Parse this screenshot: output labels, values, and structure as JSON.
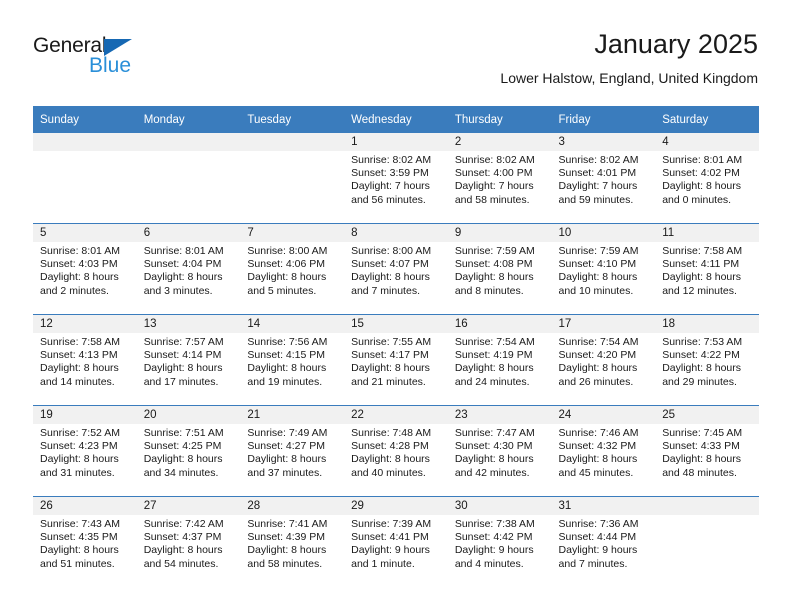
{
  "brand": {
    "name_top": "General",
    "name_bottom": "Blue",
    "accent_color": "#1668b3",
    "blue_text_color": "#2a8fd8"
  },
  "header": {
    "title": "January 2025",
    "subtitle": "Lower Halstow, England, United Kingdom"
  },
  "theme": {
    "header_bg": "#3a7cbd",
    "daynum_bg": "#f1f1f1",
    "text": "#1a1a1a"
  },
  "weekdays": [
    "Sunday",
    "Monday",
    "Tuesday",
    "Wednesday",
    "Thursday",
    "Friday",
    "Saturday"
  ],
  "weeks": [
    [
      {
        "day": "",
        "empty": true,
        "sunrise": "",
        "sunset": "",
        "daylight_line1": "",
        "daylight_line2": ""
      },
      {
        "day": "",
        "empty": true,
        "sunrise": "",
        "sunset": "",
        "daylight_line1": "",
        "daylight_line2": ""
      },
      {
        "day": "",
        "empty": true,
        "sunrise": "",
        "sunset": "",
        "daylight_line1": "",
        "daylight_line2": ""
      },
      {
        "day": "1",
        "empty": false,
        "sunrise": "Sunrise: 8:02 AM",
        "sunset": "Sunset: 3:59 PM",
        "daylight_line1": "Daylight: 7 hours",
        "daylight_line2": "and 56 minutes."
      },
      {
        "day": "2",
        "empty": false,
        "sunrise": "Sunrise: 8:02 AM",
        "sunset": "Sunset: 4:00 PM",
        "daylight_line1": "Daylight: 7 hours",
        "daylight_line2": "and 58 minutes."
      },
      {
        "day": "3",
        "empty": false,
        "sunrise": "Sunrise: 8:02 AM",
        "sunset": "Sunset: 4:01 PM",
        "daylight_line1": "Daylight: 7 hours",
        "daylight_line2": "and 59 minutes."
      },
      {
        "day": "4",
        "empty": false,
        "sunrise": "Sunrise: 8:01 AM",
        "sunset": "Sunset: 4:02 PM",
        "daylight_line1": "Daylight: 8 hours",
        "daylight_line2": "and 0 minutes."
      }
    ],
    [
      {
        "day": "5",
        "empty": false,
        "sunrise": "Sunrise: 8:01 AM",
        "sunset": "Sunset: 4:03 PM",
        "daylight_line1": "Daylight: 8 hours",
        "daylight_line2": "and 2 minutes."
      },
      {
        "day": "6",
        "empty": false,
        "sunrise": "Sunrise: 8:01 AM",
        "sunset": "Sunset: 4:04 PM",
        "daylight_line1": "Daylight: 8 hours",
        "daylight_line2": "and 3 minutes."
      },
      {
        "day": "7",
        "empty": false,
        "sunrise": "Sunrise: 8:00 AM",
        "sunset": "Sunset: 4:06 PM",
        "daylight_line1": "Daylight: 8 hours",
        "daylight_line2": "and 5 minutes."
      },
      {
        "day": "8",
        "empty": false,
        "sunrise": "Sunrise: 8:00 AM",
        "sunset": "Sunset: 4:07 PM",
        "daylight_line1": "Daylight: 8 hours",
        "daylight_line2": "and 7 minutes."
      },
      {
        "day": "9",
        "empty": false,
        "sunrise": "Sunrise: 7:59 AM",
        "sunset": "Sunset: 4:08 PM",
        "daylight_line1": "Daylight: 8 hours",
        "daylight_line2": "and 8 minutes."
      },
      {
        "day": "10",
        "empty": false,
        "sunrise": "Sunrise: 7:59 AM",
        "sunset": "Sunset: 4:10 PM",
        "daylight_line1": "Daylight: 8 hours",
        "daylight_line2": "and 10 minutes."
      },
      {
        "day": "11",
        "empty": false,
        "sunrise": "Sunrise: 7:58 AM",
        "sunset": "Sunset: 4:11 PM",
        "daylight_line1": "Daylight: 8 hours",
        "daylight_line2": "and 12 minutes."
      }
    ],
    [
      {
        "day": "12",
        "empty": false,
        "sunrise": "Sunrise: 7:58 AM",
        "sunset": "Sunset: 4:13 PM",
        "daylight_line1": "Daylight: 8 hours",
        "daylight_line2": "and 14 minutes."
      },
      {
        "day": "13",
        "empty": false,
        "sunrise": "Sunrise: 7:57 AM",
        "sunset": "Sunset: 4:14 PM",
        "daylight_line1": "Daylight: 8 hours",
        "daylight_line2": "and 17 minutes."
      },
      {
        "day": "14",
        "empty": false,
        "sunrise": "Sunrise: 7:56 AM",
        "sunset": "Sunset: 4:15 PM",
        "daylight_line1": "Daylight: 8 hours",
        "daylight_line2": "and 19 minutes."
      },
      {
        "day": "15",
        "empty": false,
        "sunrise": "Sunrise: 7:55 AM",
        "sunset": "Sunset: 4:17 PM",
        "daylight_line1": "Daylight: 8 hours",
        "daylight_line2": "and 21 minutes."
      },
      {
        "day": "16",
        "empty": false,
        "sunrise": "Sunrise: 7:54 AM",
        "sunset": "Sunset: 4:19 PM",
        "daylight_line1": "Daylight: 8 hours",
        "daylight_line2": "and 24 minutes."
      },
      {
        "day": "17",
        "empty": false,
        "sunrise": "Sunrise: 7:54 AM",
        "sunset": "Sunset: 4:20 PM",
        "daylight_line1": "Daylight: 8 hours",
        "daylight_line2": "and 26 minutes."
      },
      {
        "day": "18",
        "empty": false,
        "sunrise": "Sunrise: 7:53 AM",
        "sunset": "Sunset: 4:22 PM",
        "daylight_line1": "Daylight: 8 hours",
        "daylight_line2": "and 29 minutes."
      }
    ],
    [
      {
        "day": "19",
        "empty": false,
        "sunrise": "Sunrise: 7:52 AM",
        "sunset": "Sunset: 4:23 PM",
        "daylight_line1": "Daylight: 8 hours",
        "daylight_line2": "and 31 minutes."
      },
      {
        "day": "20",
        "empty": false,
        "sunrise": "Sunrise: 7:51 AM",
        "sunset": "Sunset: 4:25 PM",
        "daylight_line1": "Daylight: 8 hours",
        "daylight_line2": "and 34 minutes."
      },
      {
        "day": "21",
        "empty": false,
        "sunrise": "Sunrise: 7:49 AM",
        "sunset": "Sunset: 4:27 PM",
        "daylight_line1": "Daylight: 8 hours",
        "daylight_line2": "and 37 minutes."
      },
      {
        "day": "22",
        "empty": false,
        "sunrise": "Sunrise: 7:48 AM",
        "sunset": "Sunset: 4:28 PM",
        "daylight_line1": "Daylight: 8 hours",
        "daylight_line2": "and 40 minutes."
      },
      {
        "day": "23",
        "empty": false,
        "sunrise": "Sunrise: 7:47 AM",
        "sunset": "Sunset: 4:30 PM",
        "daylight_line1": "Daylight: 8 hours",
        "daylight_line2": "and 42 minutes."
      },
      {
        "day": "24",
        "empty": false,
        "sunrise": "Sunrise: 7:46 AM",
        "sunset": "Sunset: 4:32 PM",
        "daylight_line1": "Daylight: 8 hours",
        "daylight_line2": "and 45 minutes."
      },
      {
        "day": "25",
        "empty": false,
        "sunrise": "Sunrise: 7:45 AM",
        "sunset": "Sunset: 4:33 PM",
        "daylight_line1": "Daylight: 8 hours",
        "daylight_line2": "and 48 minutes."
      }
    ],
    [
      {
        "day": "26",
        "empty": false,
        "sunrise": "Sunrise: 7:43 AM",
        "sunset": "Sunset: 4:35 PM",
        "daylight_line1": "Daylight: 8 hours",
        "daylight_line2": "and 51 minutes."
      },
      {
        "day": "27",
        "empty": false,
        "sunrise": "Sunrise: 7:42 AM",
        "sunset": "Sunset: 4:37 PM",
        "daylight_line1": "Daylight: 8 hours",
        "daylight_line2": "and 54 minutes."
      },
      {
        "day": "28",
        "empty": false,
        "sunrise": "Sunrise: 7:41 AM",
        "sunset": "Sunset: 4:39 PM",
        "daylight_line1": "Daylight: 8 hours",
        "daylight_line2": "and 58 minutes."
      },
      {
        "day": "29",
        "empty": false,
        "sunrise": "Sunrise: 7:39 AM",
        "sunset": "Sunset: 4:41 PM",
        "daylight_line1": "Daylight: 9 hours",
        "daylight_line2": "and 1 minute."
      },
      {
        "day": "30",
        "empty": false,
        "sunrise": "Sunrise: 7:38 AM",
        "sunset": "Sunset: 4:42 PM",
        "daylight_line1": "Daylight: 9 hours",
        "daylight_line2": "and 4 minutes."
      },
      {
        "day": "31",
        "empty": false,
        "sunrise": "Sunrise: 7:36 AM",
        "sunset": "Sunset: 4:44 PM",
        "daylight_line1": "Daylight: 9 hours",
        "daylight_line2": "and 7 minutes."
      },
      {
        "day": "",
        "empty": true,
        "sunrise": "",
        "sunset": "",
        "daylight_line1": "",
        "daylight_line2": ""
      }
    ]
  ]
}
